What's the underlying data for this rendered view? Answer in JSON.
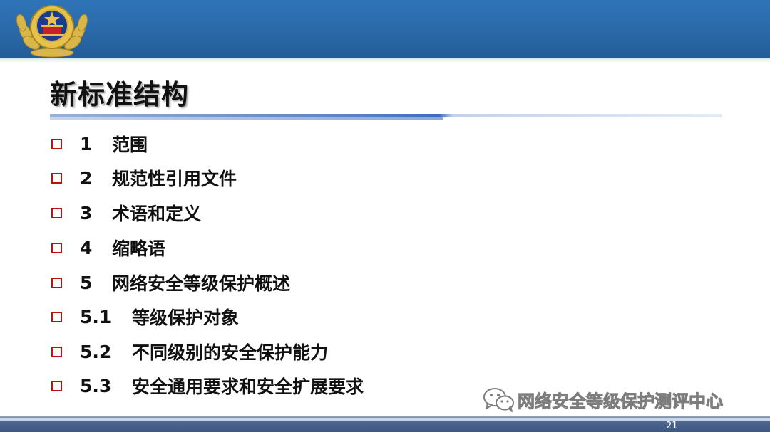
{
  "slide": {
    "title": "新标准结构",
    "page_number": "21",
    "watermark": "网络安全等级保护测评中心"
  },
  "toc": [
    {
      "num": "1",
      "label": "范围"
    },
    {
      "num": "2",
      "label": "规范性引用文件"
    },
    {
      "num": "3",
      "label": "术语和定义"
    },
    {
      "num": "4",
      "label": "缩略语"
    },
    {
      "num": "5",
      "label": "网络安全等级保护概述"
    },
    {
      "num": "5.1",
      "label": "等级保护对象"
    },
    {
      "num": "5.2",
      "label": "不同级别的安全保护能力"
    },
    {
      "num": "5.3",
      "label": "安全通用要求和安全扩展要求"
    }
  ],
  "icons": {
    "emblem": "police-emblem-icon",
    "bullet": "hollow-square-bullet-icon",
    "watermark": "wechat-icon"
  },
  "colors": {
    "banner": "#2a69a8",
    "bullet": "#c40e0e",
    "title": "#111111"
  }
}
